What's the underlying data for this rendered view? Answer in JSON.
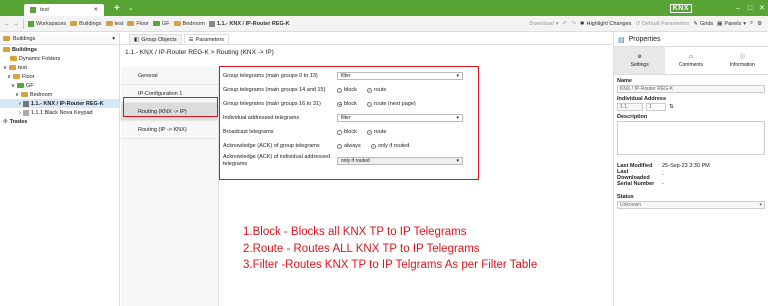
{
  "window": {
    "tab_title": "test",
    "logo": "KNX"
  },
  "toolbar": {
    "workspace": "Workspaces",
    "buildings": "Buildings",
    "test": "test",
    "floor": "Floor",
    "gf": "GF",
    "bedroom": "Bedroom",
    "device": "1.1.- KNX / IP-Router REG-K",
    "download": "Download",
    "highlight": "Highlight Changes",
    "defaults": "Default Parameters",
    "grids": "Grids",
    "panels": "Panels"
  },
  "left": {
    "head": "Buildings",
    "tree": [
      "Buildings",
      "Dynamic Folders",
      "test",
      "Floor",
      "GF",
      "Bedroom",
      "1.1.- KNX / IP-Router REG-K",
      "1.1.1 Black Nova Keypad",
      "Trades"
    ]
  },
  "main": {
    "tabs": [
      "Group Objects",
      "Parameters"
    ],
    "breadcrumb": "1.1.- KNX / IP-Router REG-K > Routing (KNX -> IP)",
    "subnav": [
      "General",
      "IP-Configuration 1",
      "Routing (KNX -> IP)",
      "Routing (IP -> KNX)"
    ],
    "params": [
      {
        "label": "Group telegrams (main groups 0 to 13)",
        "type": "dropdown",
        "value": "filter"
      },
      {
        "label": "Group telegrams (main groups 14 and 15)",
        "type": "radio",
        "options": [
          "block",
          "route"
        ],
        "selected": 1
      },
      {
        "label": "Group telegrams (main groups 16 to 31)",
        "type": "radio",
        "options": [
          "block",
          "route (next page)"
        ],
        "selected": 0
      },
      {
        "label": "Individual addressed telegrams",
        "type": "dropdown",
        "value": "filter"
      },
      {
        "label": "Broadcast telegrams",
        "type": "radio",
        "options": [
          "block",
          "route"
        ],
        "selected": 1
      },
      {
        "label": "Acknowledge (ACK) of group telegrams",
        "type": "radio",
        "options": [
          "always",
          "only if routed"
        ],
        "selected": 1
      },
      {
        "label": "Acknowledge (ACK) of individual addressed telegrams",
        "type": "dropdown",
        "value": "only if routed"
      }
    ],
    "notes": [
      "1.Block - Blocks all KNX TP to IP Telegrams",
      "2.Route  - Routes ALL KNX TP to IP Telegrams",
      "3.Filter  -Routes KNX TP to IP Telgrams As per Filter Table"
    ]
  },
  "properties": {
    "title": "Properties",
    "tabs": [
      "Settings",
      "Comments",
      "Information"
    ],
    "name_label": "Name",
    "name_value": "KNX / IP-Router REG-K",
    "addr_label": "Individual Address",
    "addr_value": "1.1.",
    "addr_suffix": "1",
    "desc_label": "Description",
    "last_modified_label": "Last Modified",
    "last_modified_value": "25-Sep-23 3:30 PM",
    "last_downloaded_label": "Last Downloaded",
    "last_downloaded_value": "-",
    "serial_label": "Serial Number",
    "serial_value": "-",
    "status_label": "Status",
    "status_value": "Unknown"
  },
  "colors": {
    "accent": "#58a435",
    "highlight": "#e0141e"
  }
}
